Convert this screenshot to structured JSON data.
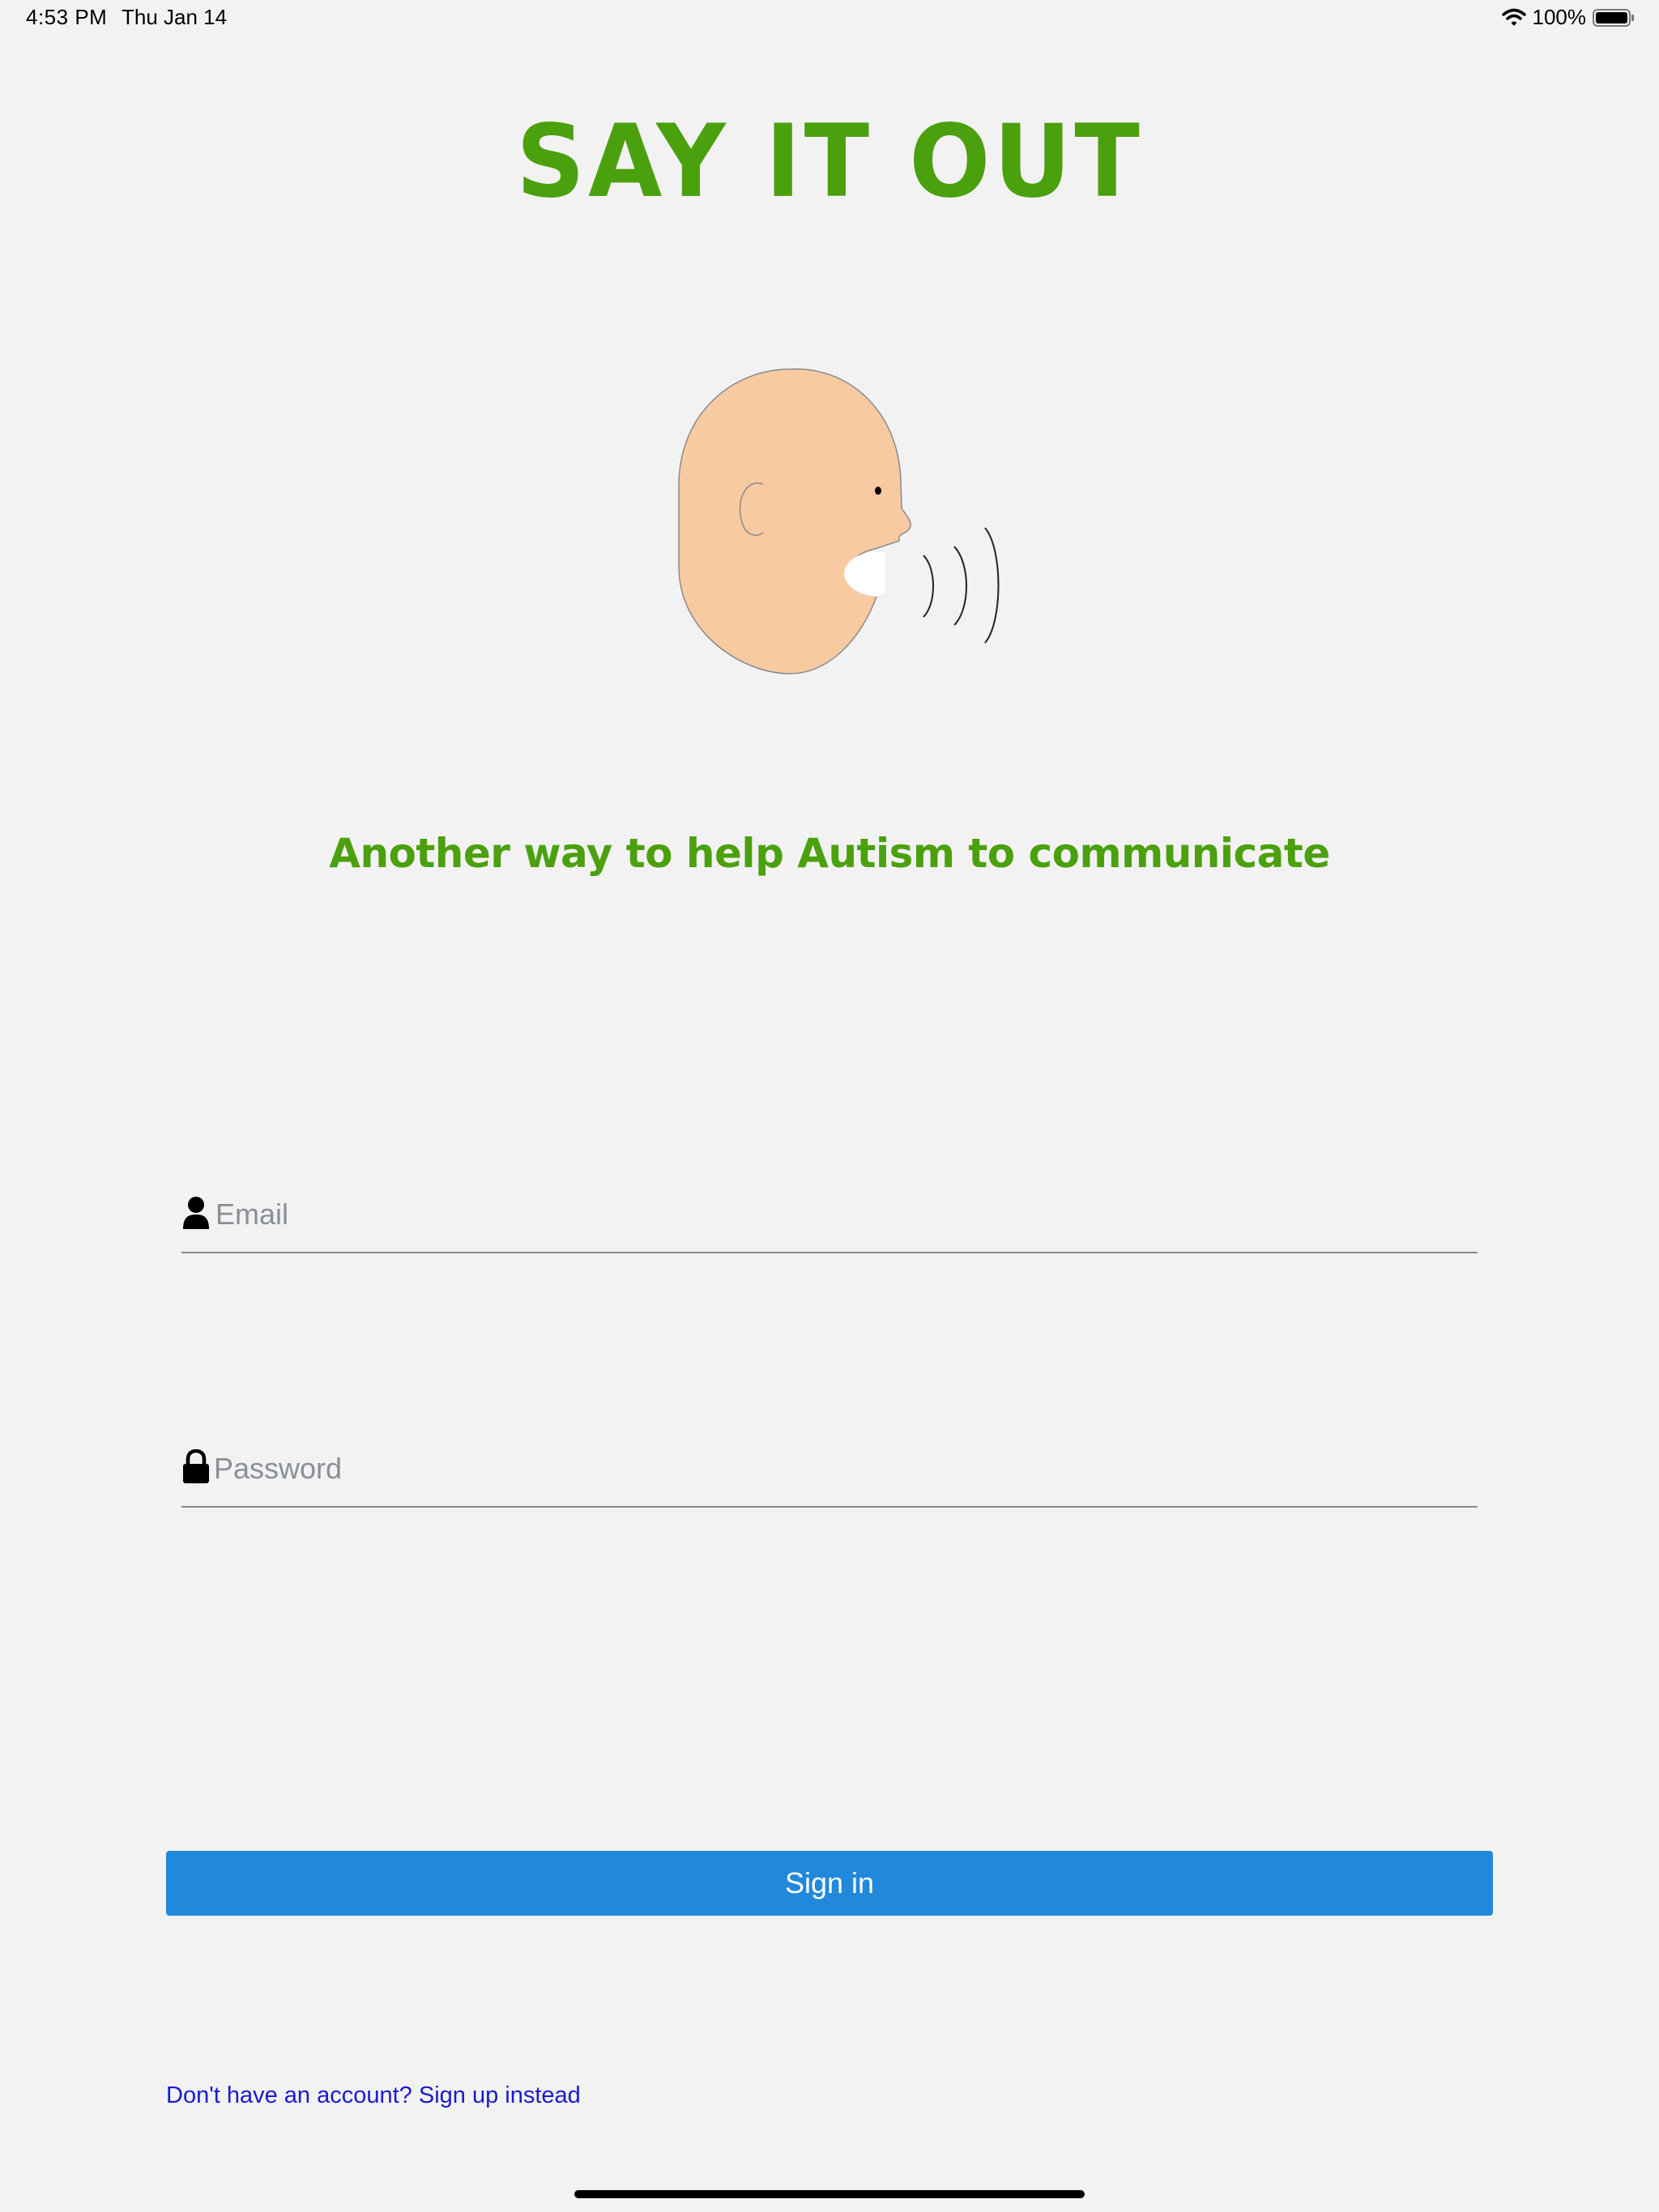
{
  "status_bar": {
    "time": "4:53 PM",
    "date": "Thu Jan 14",
    "battery": "100%",
    "wifi_icon": "wifi-icon",
    "battery_icon": "battery-full-icon"
  },
  "app": {
    "title": "SAY IT OUT",
    "tagline": "Another way to help Autism to communicate",
    "brand_color": "#4ba00e",
    "illustration": "speaking-head-icon"
  },
  "form": {
    "email": {
      "icon": "user-icon",
      "placeholder": "Email",
      "value": ""
    },
    "password": {
      "icon": "lock-icon",
      "placeholder": "Password",
      "value": ""
    },
    "signin_label": "Sign in",
    "signin_color": "#2089dc",
    "signup_link": "Don't have an account? Sign up instead"
  }
}
